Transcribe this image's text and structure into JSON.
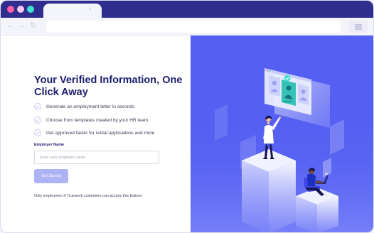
{
  "browser": {
    "traffic_lights": [
      {
        "name": "close",
        "color": "#ff5fa8"
      },
      {
        "name": "minimize",
        "color": "#f7c8ec"
      },
      {
        "name": "maximize",
        "color": "#3ee0d1"
      }
    ],
    "tab_close_glyph": "×",
    "back_glyph": "←",
    "forward_glyph": "→",
    "reload_glyph": "↻",
    "address_value": ""
  },
  "colors": {
    "chrome": "#2f2e8f",
    "brand_dark": "#1f1d6f",
    "accent": "#5560f2",
    "button": "#aeb3f7",
    "illustration_bg": "#5560f2"
  },
  "promo": {
    "headline": "Your Verified Information, One Click Away",
    "features": [
      "Generate an employment letter in seconds",
      "Choose from templates created by your HR team",
      "Get approved faster for rental applications and more"
    ]
  },
  "form": {
    "employer_label": "Employer Name",
    "employer_placeholder": "Enter your employer name",
    "employer_value": "",
    "submit_label": "Get Started",
    "submit_enabled": false
  },
  "footnote": "Only employees of Truework customers can access this feature."
}
